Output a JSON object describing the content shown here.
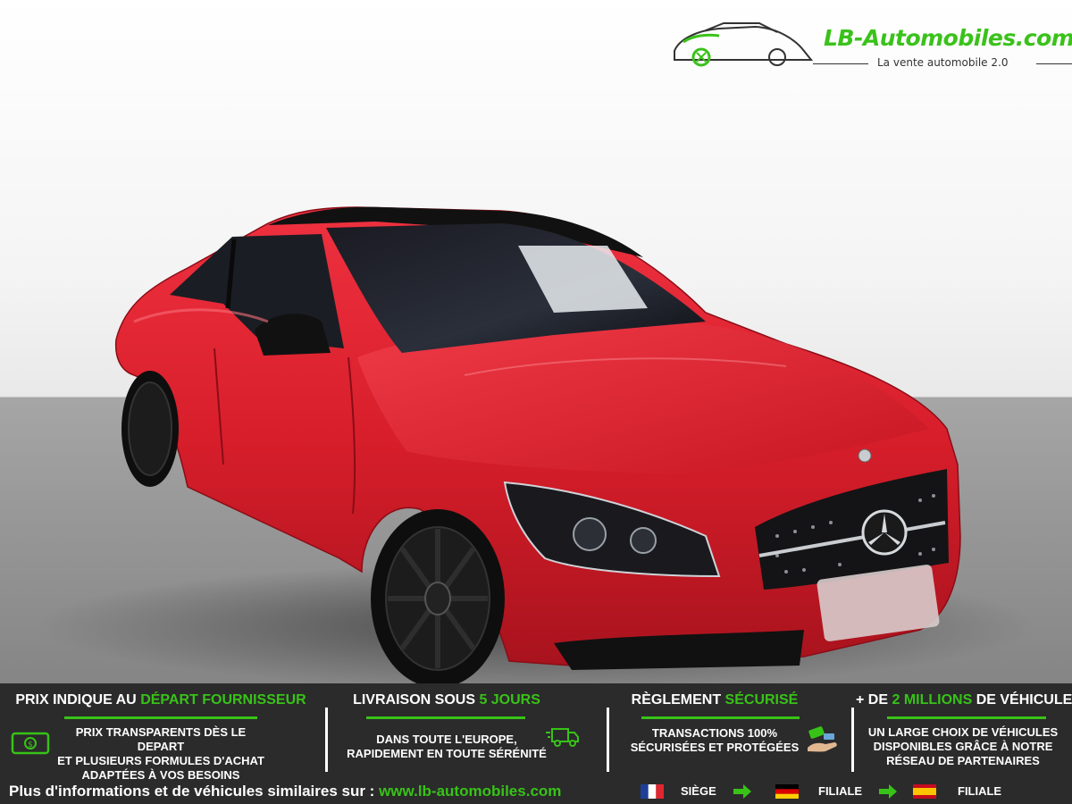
{
  "logo": {
    "name": "LB-Automobiles.com",
    "tagline": "La vente automobile 2.0",
    "green": "#3ac21a"
  },
  "photo": {
    "car_color": "#d81e2b",
    "roof_color": "#111111",
    "icons": [
      "car-photo",
      "mercedes-star-icon"
    ]
  },
  "banner": {
    "background": "#2b2b2b",
    "accent": "#38c218",
    "columns": [
      {
        "title_prefix": "PRIX INDIQUE AU ",
        "title_accent": "DÉPART FOURNISSEUR",
        "title_suffix": "",
        "lines": [
          "PRIX TRANSPARENTS DÈS LE DEPART",
          "ET PLUSIEURS FORMULES D'ACHAT",
          "ADAPTÉES À VOS BESOINS"
        ],
        "icon": "money-bill-icon"
      },
      {
        "title_prefix": "LIVRAISON SOUS ",
        "title_accent": "5 JOURS",
        "title_suffix": "",
        "lines": [
          "DANS TOUTE L'EUROPE,",
          "RAPIDEMENT EN TOUTE SÉRÉNITÉ"
        ],
        "icon": "delivery-truck-icon"
      },
      {
        "title_prefix": "RÈGLEMENT ",
        "title_accent": "SÉCURISÉ",
        "title_suffix": "",
        "lines": [
          "TRANSACTIONS 100%",
          "SÉCURISÉES ET PROTÉGÉES"
        ],
        "icon": "payment-hand-icon"
      },
      {
        "title_prefix": "+ DE ",
        "title_accent": "2 MILLIONS",
        "title_suffix": " DE VÉHICULES",
        "lines": [
          "UN LARGE CHOIX DE VÉHICULES",
          "DISPONIBLES GRÂCE À NOTRE",
          "RÉSEAU DE PARTENAIRES"
        ],
        "icon": ""
      }
    ],
    "footer": {
      "text": "Plus d'informations et de véhicules similaires sur : ",
      "url": "www.lb-automobiles.com"
    },
    "locations": [
      {
        "flag": "france-flag-icon",
        "label": "SIÈGE"
      },
      {
        "flag": "germany-flag-icon",
        "label": "FILIALE"
      },
      {
        "flag": "spain-flag-icon",
        "label": "FILIALE"
      }
    ]
  }
}
